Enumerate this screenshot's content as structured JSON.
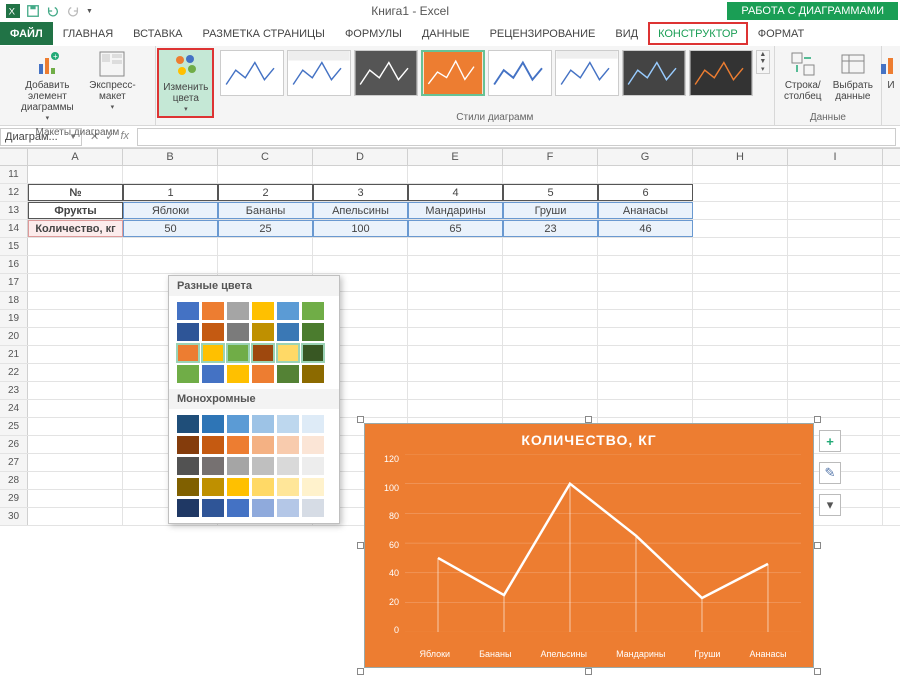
{
  "title": "Книга1 - Excel",
  "context_tab": "РАБОТА С ДИАГРАММАМИ",
  "tabs": {
    "file": "ФАЙЛ",
    "items": [
      "ГЛАВНАЯ",
      "ВСТАВКА",
      "РАЗМЕТКА СТРАНИЦЫ",
      "ФОРМУЛЫ",
      "ДАННЫЕ",
      "РЕЦЕНЗИРОВАНИЕ",
      "ВИД",
      "КОНСТРУКТОР",
      "ФОРМАТ"
    ]
  },
  "ribbon": {
    "group_layouts": "Макеты диаграмм",
    "group_styles": "Стили диаграмм",
    "group_data": "Данные",
    "btn_add_element": "Добавить элемент диаграммы",
    "btn_express": "Экспресс-макет",
    "btn_colors": "Изменить цвета",
    "btn_rowcol": "Строка/столбец",
    "btn_select": "Выбрать данные",
    "btn_change_type_short": "И"
  },
  "dropdown": {
    "section1": "Разные цвета",
    "section2": "Монохромные",
    "varied_rows": [
      [
        "#4472c4",
        "#ed7d31",
        "#a5a5a5",
        "#ffc000",
        "#5b9bd5",
        "#70ad47"
      ],
      [
        "#2e5597",
        "#c45a12",
        "#7b7b7b",
        "#bf9000",
        "#3a78b5",
        "#4b7c2e"
      ],
      [
        "#ed7d31",
        "#ffc000",
        "#70ad47",
        "#9e480e",
        "#ffd966",
        "#385723"
      ],
      [
        "#70ad47",
        "#4472c4",
        "#ffc000",
        "#ed7d31",
        "#548235",
        "#8c6a00"
      ]
    ],
    "mono_rows": [
      [
        "#1f4e79",
        "#2e75b6",
        "#5b9bd5",
        "#9dc3e6",
        "#bdd7ee",
        "#deebf7"
      ],
      [
        "#843c0c",
        "#c55a11",
        "#ed7d31",
        "#f4b183",
        "#f8cbad",
        "#fbe5d6"
      ],
      [
        "#525252",
        "#767171",
        "#a5a5a5",
        "#bfbfbf",
        "#d9d9d9",
        "#ededed"
      ],
      [
        "#806000",
        "#bf9000",
        "#ffc000",
        "#ffd966",
        "#ffe699",
        "#fff2cc"
      ],
      [
        "#1f3864",
        "#2f5597",
        "#4472c4",
        "#8faadc",
        "#b4c7e7",
        "#d6dce5"
      ]
    ]
  },
  "namebox": "Диаграм...",
  "columns": [
    "A",
    "B",
    "C",
    "D",
    "E",
    "F",
    "G",
    "H",
    "I"
  ],
  "row_start": 11,
  "table": {
    "headers": [
      "№",
      "Фрукты",
      "Количество, кг"
    ],
    "num_row": [
      "",
      "1",
      "2",
      "3",
      "4",
      "5",
      "6"
    ],
    "fruit_row": [
      "",
      "Яблоки",
      "Бананы",
      "Апельсины",
      "Мандарины",
      "Груши",
      "Ананасы"
    ],
    "qty_row": [
      "",
      "50",
      "25",
      "100",
      "65",
      "23",
      "46"
    ]
  },
  "chart_data": {
    "type": "line",
    "title": "КОЛИЧЕСТВО, КГ",
    "categories": [
      "Яблоки",
      "Бананы",
      "Апельсины",
      "Мандарины",
      "Груши",
      "Ананасы"
    ],
    "values": [
      50,
      25,
      100,
      65,
      23,
      46
    ],
    "ylim": [
      0,
      120
    ],
    "yticks": [
      0,
      20,
      40,
      60,
      80,
      100,
      120
    ],
    "xlabel": "",
    "ylabel": ""
  },
  "side_icons": {
    "plus": "+",
    "brush": "✎",
    "filter": "▾"
  }
}
